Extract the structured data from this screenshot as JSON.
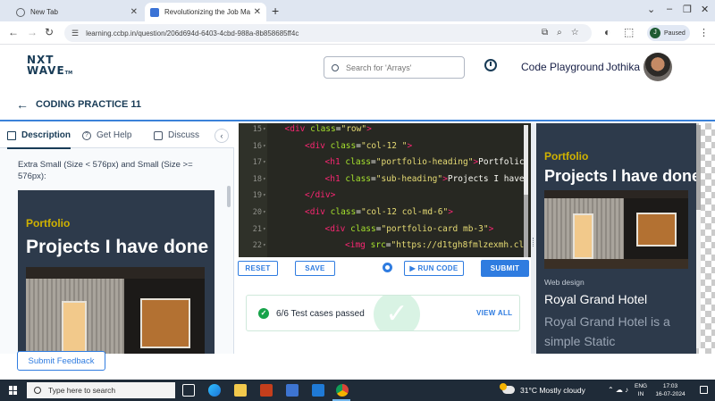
{
  "browser": {
    "tabs": [
      {
        "title": "New Tab",
        "active": false
      },
      {
        "title": "Revolutionizing the Job Market",
        "active": true
      }
    ],
    "url": "learning.ccbp.in/question/206d694d-6403-4cbd-988a-8b858685ff4c",
    "profile_initial": "J",
    "profile_status": "Paused"
  },
  "header": {
    "logo_line1": "NXT",
    "logo_line2": "WAVE",
    "logo_tm": "TM",
    "search_placeholder": "Search for 'Arrays'",
    "code_playground": "Code Playground",
    "user_name": "Jothika"
  },
  "page": {
    "title": "CODING PRACTICE 11"
  },
  "left_panel": {
    "tabs": [
      "Description",
      "Get Help",
      "Discuss"
    ],
    "active_tab": "Description",
    "text": "Extra Small (Size < 576px) and Small (Size >= 576px):",
    "preview": {
      "eyebrow": "Portfolio",
      "heading": "Projects I have done"
    },
    "feedback_button": "Submit Feedback"
  },
  "editor": {
    "lines": [
      {
        "num": "15",
        "indent": 1,
        "parts": [
          [
            "tag",
            "<div"
          ],
          [
            "pun",
            " "
          ],
          [
            "attr",
            "class"
          ],
          [
            "pun",
            "="
          ],
          [
            "str",
            "\"row\""
          ],
          [
            "tag",
            ">"
          ]
        ]
      },
      {
        "num": "16",
        "indent": 2,
        "parts": [
          [
            "tag",
            "<div"
          ],
          [
            "pun",
            " "
          ],
          [
            "attr",
            "class"
          ],
          [
            "pun",
            "="
          ],
          [
            "str",
            "\"col-12 \""
          ],
          [
            "tag",
            ">"
          ]
        ]
      },
      {
        "num": "17",
        "indent": 3,
        "parts": [
          [
            "tag",
            "<h1"
          ],
          [
            "pun",
            " "
          ],
          [
            "attr",
            "class"
          ],
          [
            "pun",
            "="
          ],
          [
            "str",
            "\"portfolio-heading\""
          ],
          [
            "tag",
            ">"
          ],
          [
            "pun",
            "Portfolic"
          ]
        ]
      },
      {
        "num": "18",
        "indent": 3,
        "parts": [
          [
            "tag",
            "<h1"
          ],
          [
            "pun",
            " "
          ],
          [
            "attr",
            "class"
          ],
          [
            "pun",
            "="
          ],
          [
            "str",
            "\"sub-heading\""
          ],
          [
            "tag",
            ">"
          ],
          [
            "pun",
            "Projects I have"
          ]
        ]
      },
      {
        "num": "19",
        "indent": 2,
        "parts": [
          [
            "tag",
            "</div>"
          ]
        ]
      },
      {
        "num": "20",
        "indent": 2,
        "parts": [
          [
            "tag",
            "<div"
          ],
          [
            "pun",
            " "
          ],
          [
            "attr",
            "class"
          ],
          [
            "pun",
            "="
          ],
          [
            "str",
            "\"col-12 col-md-6\""
          ],
          [
            "tag",
            ">"
          ]
        ]
      },
      {
        "num": "21",
        "indent": 3,
        "parts": [
          [
            "tag",
            "<div"
          ],
          [
            "pun",
            " "
          ],
          [
            "attr",
            "class"
          ],
          [
            "pun",
            "="
          ],
          [
            "str",
            "\"portfolio-card  mb-3\""
          ],
          [
            "tag",
            ">"
          ]
        ]
      },
      {
        "num": "22",
        "indent": 4,
        "parts": [
          [
            "tag",
            "<img"
          ],
          [
            "pun",
            " "
          ],
          [
            "attr",
            "src"
          ],
          [
            "pun",
            "="
          ],
          [
            "str",
            "\"https://d1tgh8fmlzexmh.cl"
          ]
        ]
      }
    ]
  },
  "actions": {
    "reset": "RESET",
    "save": "SAVE",
    "run_code": "▶ RUN CODE",
    "submit": "SUBMIT"
  },
  "results": {
    "passed_text": "6/6 Test cases passed",
    "view_all": "VIEW ALL"
  },
  "output_preview": {
    "eyebrow": "Portfolio",
    "heading": "Projects I have done",
    "category": "Web design",
    "hotel_title": "Royal Grand Hotel",
    "description": "Royal Grand Hotel is a simple Static"
  },
  "taskbar": {
    "search_placeholder": "Type here to search",
    "weather": "31°C  Mostly cloudy",
    "lang_1": "ENG",
    "lang_2": "IN",
    "time": "17:03",
    "date": "16-07-2024"
  },
  "colors": {
    "brand_navy": "#183b56",
    "accent_blue": "#2f7ce0",
    "success_green": "#17a34a",
    "card_bg": "#2d3a4b",
    "portfolio_yellow": "#d0b200",
    "editor_bg": "#272822"
  }
}
